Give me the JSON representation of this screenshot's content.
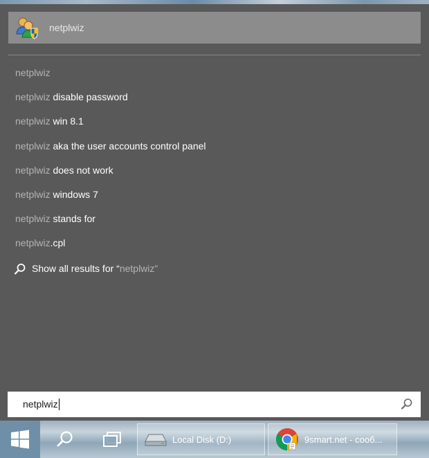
{
  "search": {
    "query": "netplwiz",
    "top_result": {
      "label": "netplwiz",
      "icon": "user-accounts-icon"
    },
    "suggestions": [
      {
        "query": "netplwiz",
        "rest": ""
      },
      {
        "query": "netplwiz",
        "rest": " disable password"
      },
      {
        "query": "netplwiz",
        "rest": " win 8.1"
      },
      {
        "query": "netplwiz",
        "rest": " aka the user accounts control panel"
      },
      {
        "query": "netplwiz",
        "rest": " does not work"
      },
      {
        "query": "netplwiz",
        "rest": " windows 7"
      },
      {
        "query": "netplwiz",
        "rest": " stands for"
      },
      {
        "query": "netplwiz",
        "rest": ".cpl"
      }
    ],
    "show_all": {
      "prefix": "Show all results for “",
      "query": "netplwiz",
      "suffix": "”",
      "icon": "search-icon"
    },
    "box_icon": "search-icon"
  },
  "taskbar": {
    "start_icon": "windows-logo-icon",
    "search_icon": "search-icon",
    "task_view_icon": "task-view-icon",
    "apps": [
      {
        "label": "Local Disk (D:)",
        "icon": "drive-icon"
      },
      {
        "label": "9smart.net - сооб...",
        "icon": "chrome-icon"
      }
    ]
  },
  "colors": {
    "panel": "#595959",
    "top_result_bg": "#8c8c8c",
    "muted_text": "#b4b4b4",
    "text": "#ffffff"
  }
}
